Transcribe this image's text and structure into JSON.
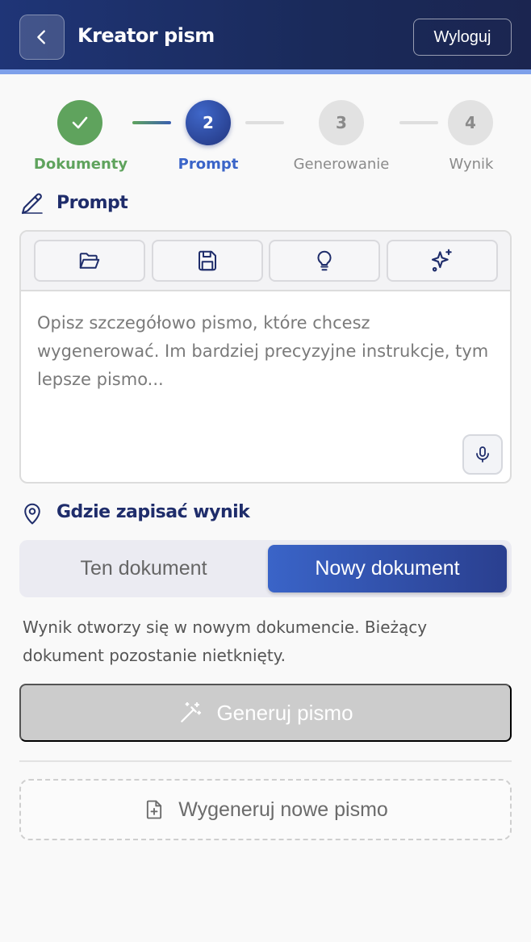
{
  "header": {
    "title": "Kreator pism",
    "logout_label": "Wyloguj",
    "gradient_start": "#1f3577",
    "accent_bar": "#7ea0ea"
  },
  "stepper": {
    "steps": [
      {
        "label": "Dokumenty",
        "state": "done",
        "icon": "check-icon"
      },
      {
        "label": "Prompt",
        "number": "2",
        "state": "active"
      },
      {
        "label": "Generowanie",
        "number": "3",
        "state": "pending"
      },
      {
        "label": "Wynik",
        "number": "4",
        "state": "pending"
      }
    ],
    "colors": {
      "done": "#5fa35d",
      "active": "#2f4ba3",
      "pending": "#e2e2e2"
    }
  },
  "prompt_section": {
    "title": "Prompt",
    "icon": "pencil-icon",
    "toolbar": [
      "folder-open-icon",
      "save-icon",
      "lightbulb-icon",
      "sparkles-icon"
    ],
    "placeholder": "Opisz szczegółowo pismo, które chcesz wygenerować. Im bardziej precyzyjne instrukcje, tym lepsze pismo...",
    "value": "",
    "mic_icon": "microphone-icon"
  },
  "destination_section": {
    "title": "Gdzie zapisać wynik",
    "icon": "map-pin-icon",
    "options": [
      "Ten dokument",
      "Nowy dokument"
    ],
    "selected": "Nowy dokument",
    "info": "Wynik otworzy się w nowym dokumencie. Bieżący dokument pozostanie nietknięty."
  },
  "actions": {
    "generate_label": "Generuj pismo",
    "generate_icon": "magic-wand-icon",
    "generate_disabled": true,
    "new_label": "Wygeneruj nowe pismo",
    "new_icon": "file-plus-icon"
  }
}
